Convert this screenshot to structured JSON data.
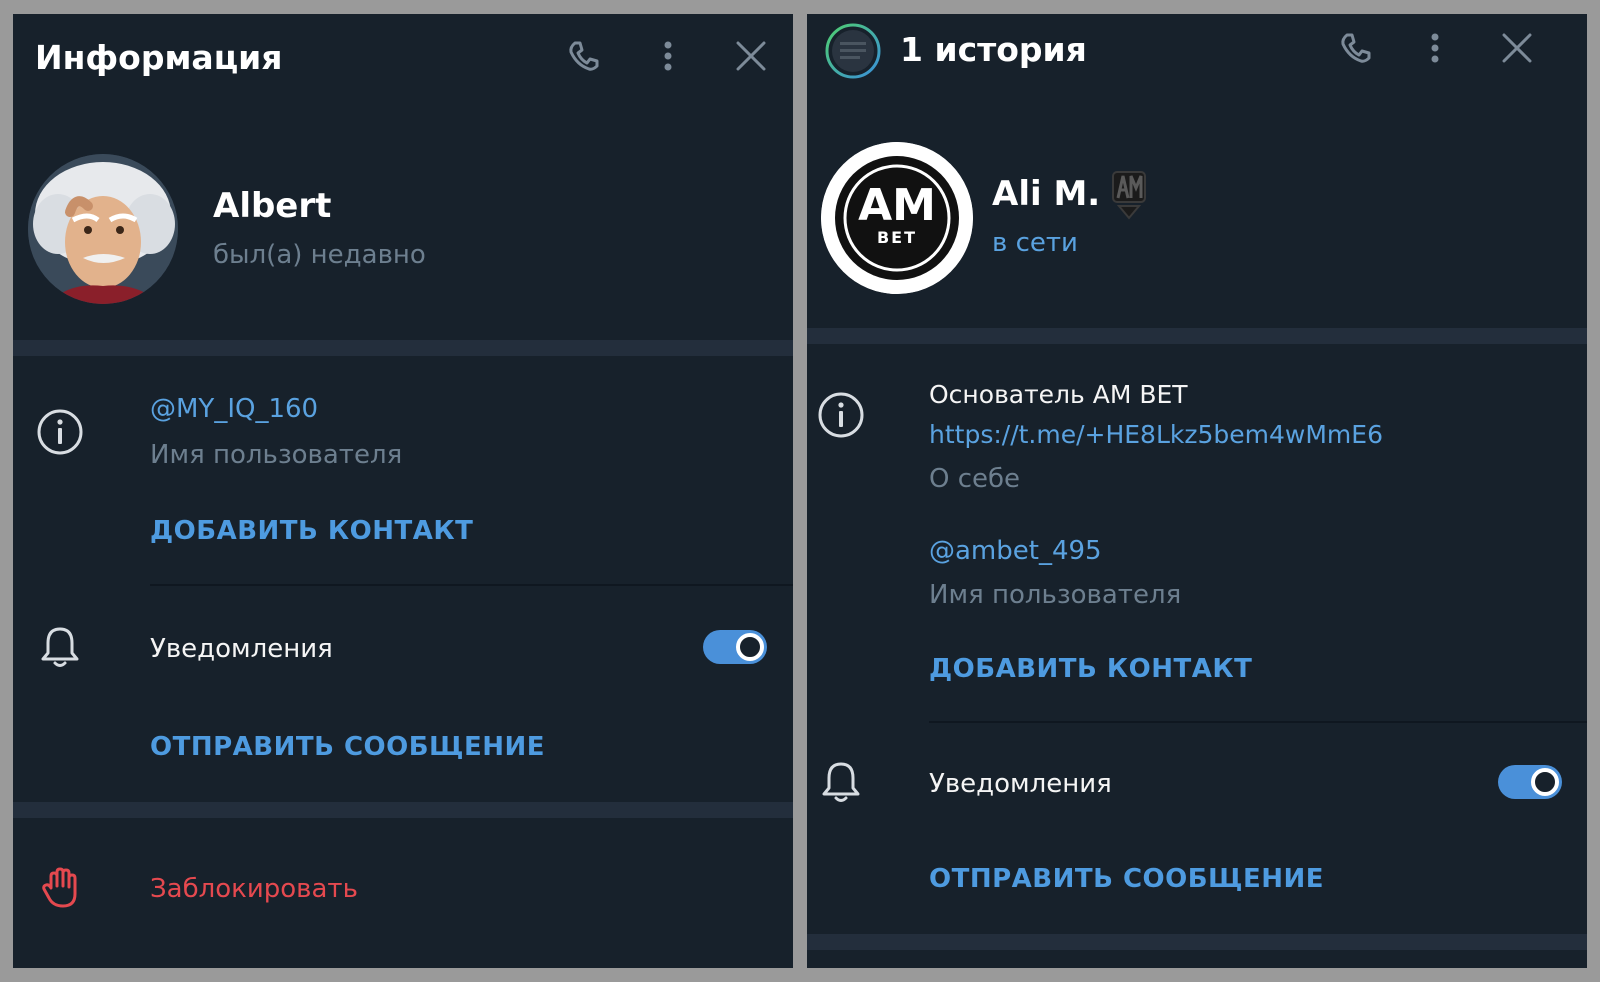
{
  "left": {
    "header": {
      "title": "Информация"
    },
    "profile": {
      "name": "Albert",
      "status": "был(а) недавно"
    },
    "info": {
      "username": "@MY_IQ_160",
      "username_caption": "Имя пользователя",
      "add_contact": "ДОБАВИТЬ КОНТАКТ"
    },
    "notifications": {
      "label": "Уведомления",
      "enabled": true
    },
    "send_message": "ОТПРАВИТЬ СООБЩЕНИЕ",
    "block": "Заблокировать"
  },
  "right": {
    "header": {
      "title": "1 история"
    },
    "profile": {
      "name": "Ali M.",
      "status": "в сети",
      "avatar_logo_top": "AM",
      "avatar_logo_bottom": "BET"
    },
    "info": {
      "bio": "Основатель AM BET",
      "bio_link": "https://t.me/+HE8Lkz5bem4wMmE6",
      "bio_caption": "О себе",
      "username": "@ambet_495",
      "username_caption": "Имя пользователя",
      "add_contact": "ДОБАВИТЬ КОНТАКТ"
    },
    "notifications": {
      "label": "Уведомления",
      "enabled": true
    },
    "send_message": "ОТПРАВИТЬ СООБЩЕНИЕ"
  },
  "colors": {
    "panel_bg": "#17212b",
    "accent": "#4e9be0",
    "link": "#5aa2e0",
    "danger": "#e5494f",
    "muted": "#6d7f8f"
  }
}
